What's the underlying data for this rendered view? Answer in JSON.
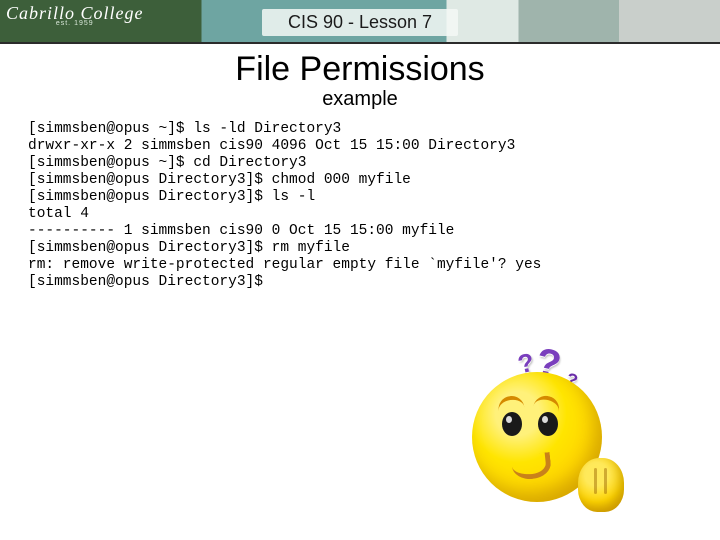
{
  "banner": {
    "logo_text": "Cabrillo College",
    "logo_sub": "est. 1959",
    "title": "CIS 90 - Lesson 7"
  },
  "headings": {
    "h1": "File Permissions",
    "h2": "example"
  },
  "terminal_lines": [
    "[simmsben@opus ~]$ ls -ld Directory3",
    "drwxr-xr-x 2 simmsben cis90 4096 Oct 15 15:00 Directory3",
    "[simmsben@opus ~]$ cd Directory3",
    "[simmsben@opus Directory3]$ chmod 000 myfile",
    "[simmsben@opus Directory3]$ ls -l",
    "total 4",
    "---------- 1 simmsben cis90 0 Oct 15 15:00 myfile",
    "[simmsben@opus Directory3]$ rm myfile",
    "rm: remove write-protected regular empty file `myfile'? yes",
    "[simmsben@opus Directory3]$"
  ],
  "emoji": {
    "q1": "?",
    "q2": "?",
    "q3": "?"
  }
}
